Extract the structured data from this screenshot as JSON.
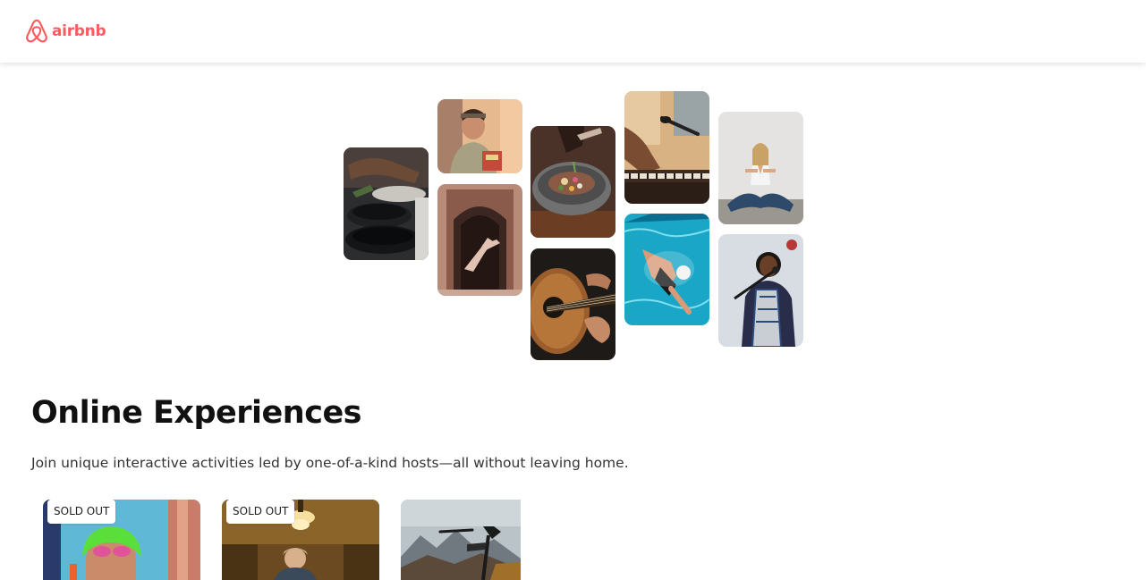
{
  "brand": {
    "name": "airbnb",
    "color": "#FF5A5F"
  },
  "hero": {
    "photos": [
      {
        "name": "cooking-pans-photo",
        "icon": "cooking-photo"
      },
      {
        "name": "smiling-woman-photo",
        "icon": "portrait-photo"
      },
      {
        "name": "dancer-doorway-photo",
        "icon": "dance-photo"
      },
      {
        "name": "food-bowl-photo",
        "icon": "food-photo"
      },
      {
        "name": "guitar-photo",
        "icon": "guitar-photo"
      },
      {
        "name": "keyboard-microphone-photo",
        "icon": "music-photo"
      },
      {
        "name": "swimmer-photo",
        "icon": "swimming-photo"
      },
      {
        "name": "yoga-photo",
        "icon": "yoga-photo"
      },
      {
        "name": "singer-photo",
        "icon": "singer-photo"
      }
    ]
  },
  "main": {
    "title": "Online Experiences",
    "subtitle": "Join unique interactive activities led by one-of-a-kind hosts—all without leaving home."
  },
  "cards": [
    {
      "badge": "SOLD OUT",
      "photo": "swimmer-goggles-photo"
    },
    {
      "badge": "SOLD OUT",
      "photo": "host-portrait-photo"
    },
    {
      "badge": "",
      "photo": "mountain-bike-photo"
    }
  ]
}
